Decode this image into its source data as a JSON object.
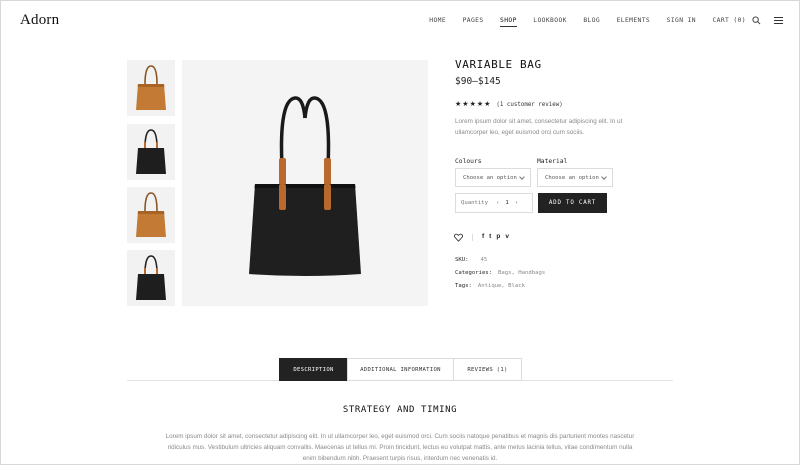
{
  "header": {
    "logo": "Adorn",
    "nav": [
      "HOME",
      "PAGES",
      "SHOP",
      "LOOKBOOK",
      "BLOG",
      "ELEMENTS",
      "SIGN IN",
      "CART (0)"
    ],
    "active_nav": "SHOP",
    "search_icon": "search-icon",
    "menu_icon": "hamburger-menu-icon"
  },
  "gallery": {
    "thumbnails": [
      "tan leather tote bag",
      "black tote bag",
      "tan leather tote bag",
      "black tote bag"
    ],
    "main_image": "black leather tote bag with tan handles"
  },
  "product": {
    "title": "VARIABLE BAG",
    "price": "$90–$145",
    "rating": 5,
    "review_text": "(1 customer review)",
    "short_description": "Lorem ipsum dolor sit amet, consectetur adipiscing elit. In ut ullamcorper leo, eget euismod orci cum sociis.",
    "variations": [
      {
        "label": "Colours",
        "placeholder": "Choose an option"
      },
      {
        "label": "Material",
        "placeholder": "Choose an option"
      }
    ],
    "quantity_label": "Quantity",
    "quantity_minus": "‹",
    "quantity_value": "1",
    "quantity_plus": "›",
    "add_to_cart": "ADD TO CART",
    "social": [
      "f",
      "t",
      "p",
      "v"
    ],
    "meta": [
      {
        "label": "SKU:",
        "value": "45"
      },
      {
        "label": "Categories:",
        "value": "Bags, Handbags"
      },
      {
        "label": "Tags:",
        "value": "Antique, Black"
      }
    ]
  },
  "tabs": [
    {
      "label": "DESCRIPTION",
      "active": true
    },
    {
      "label": "ADDITIONAL INFORMATION",
      "active": false
    },
    {
      "label": "REVIEWS (1)",
      "active": false
    }
  ],
  "description": {
    "title": "STRATEGY AND TIMING",
    "text": "Lorem ipsum dolor sit amet, consectetur adipiscing elit. In ut ullamcorper leo, eget euismod orci. Cum sociis natoque penatibus et magnis dis parturient montes nascetur ridiculus mus. Vestibulum ultricies aliquam convallis. Maecenas ut tellus mi. Proin tincidunt, lectus eu volutpat mattis, ante metus lacinia tellus, vitae condimentum nulla enim bibendum nibh. Praesent turpis risus, interdum nec venenatis id."
  },
  "colors": {
    "accent_dark": "#222222",
    "leather_tan": "#c27a35",
    "text_muted": "#8a8a8a"
  }
}
